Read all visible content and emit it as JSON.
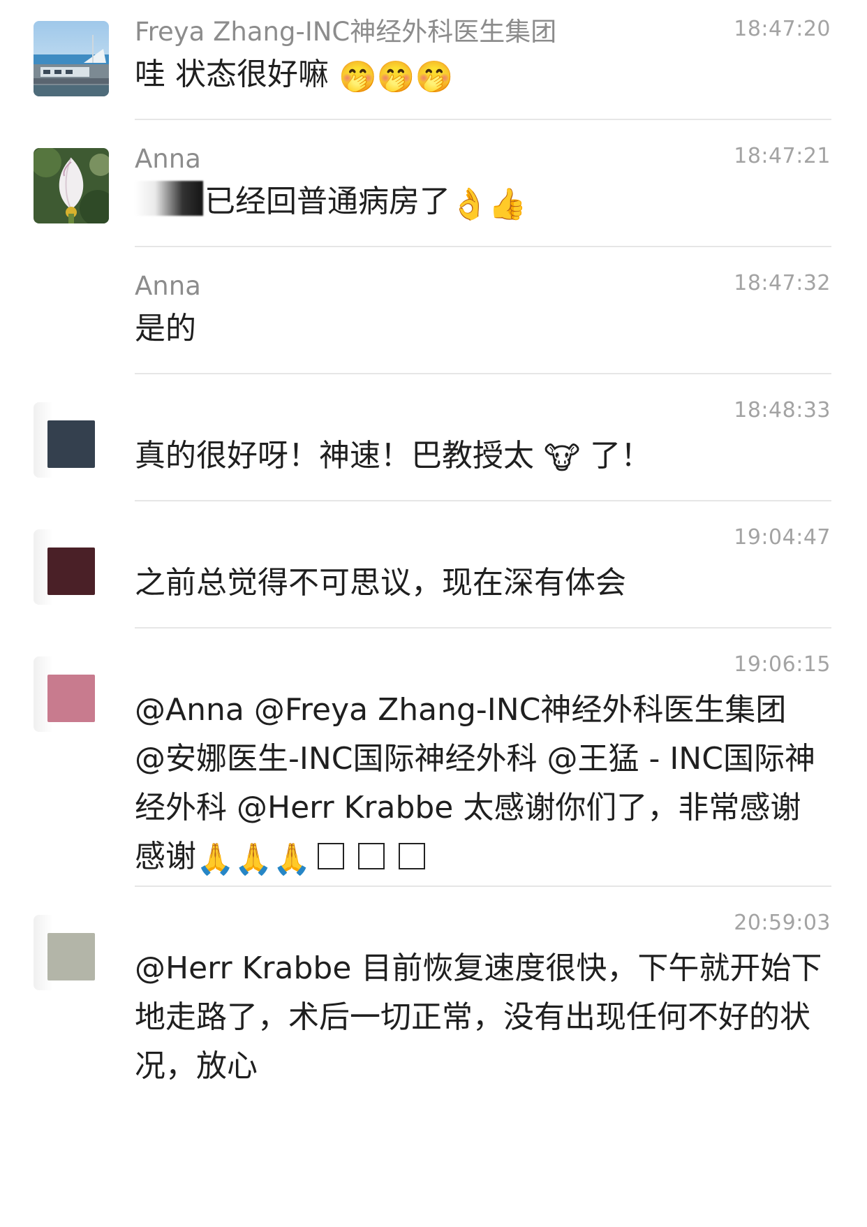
{
  "messages": [
    {
      "name": "Freya Zhang-INC神经外科医生集团",
      "time": "18:47:20",
      "text": "哇 状态很好嘛",
      "emojis": [
        "🤭",
        "🤭",
        "🤭"
      ]
    },
    {
      "name": "Anna",
      "time": "18:47:21",
      "text": "已经回普通病房了",
      "emojis": [
        "👌",
        "👍"
      ]
    },
    {
      "name": "Anna",
      "time": "18:47:32",
      "text": "是的"
    },
    {
      "time": "18:48:33",
      "text_before": "真的很好呀！神速！巴教授太",
      "emoji": "🐮",
      "text_after": " 了！"
    },
    {
      "time": "19:04:47",
      "text": "之前总觉得不可思议，现在深有体会"
    },
    {
      "time": "19:06:15",
      "text": "@Anna @Freya Zhang-INC神经外科医生集团 @安娜医生-INC国际神经外科 @王猛 - INC国际神经外科 @Herr Krabbe 太感谢你们了，非常感谢感谢",
      "emojis": [
        "🙏",
        "🙏",
        "🙏"
      ]
    },
    {
      "time": "20:59:03",
      "text": "@Herr Krabbe 目前恢复速度很快，下午就开始下地走路了，术后一切正常，没有出现任何不好的状况，放心"
    }
  ],
  "colors": {
    "name": "#8c8c8c",
    "time": "#a3a3a3",
    "text": "#1f1f1f",
    "divider": "#e6e6e6",
    "avatar_slate": "#34404e",
    "avatar_maroon": "#4a2027",
    "avatar_pink": "#c87b8e",
    "avatar_sage": "#b3b5a8"
  }
}
